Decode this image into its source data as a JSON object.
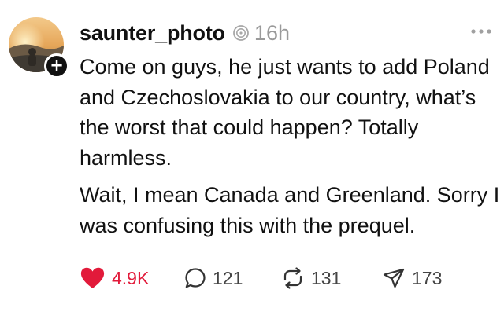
{
  "post": {
    "username": "saunter_photo",
    "timestamp": "16h",
    "verified_icon": "verified-badge-icon",
    "more_icon": "more-options-icon",
    "avatar": {
      "follow_symbol": "+",
      "colors": {
        "sky": "#e6a75a",
        "sun": "#f7d08a",
        "ground": "#3f3a33"
      }
    },
    "paragraphs": [
      "Come on guys, he just wants to add Poland and Czechoslovakia to our country, what’s the worst that could happen? Totally harmless.",
      "Wait, I mean Canada and Greenland. Sorry I was confusing this with the prequel."
    ],
    "actions": {
      "like": {
        "icon": "heart-icon",
        "count": "4.9K",
        "liked": true,
        "color": "#e21a3a"
      },
      "reply": {
        "icon": "reply-icon",
        "count": "121"
      },
      "repost": {
        "icon": "repost-icon",
        "count": "131"
      },
      "share": {
        "icon": "share-icon",
        "count": "173"
      }
    }
  }
}
